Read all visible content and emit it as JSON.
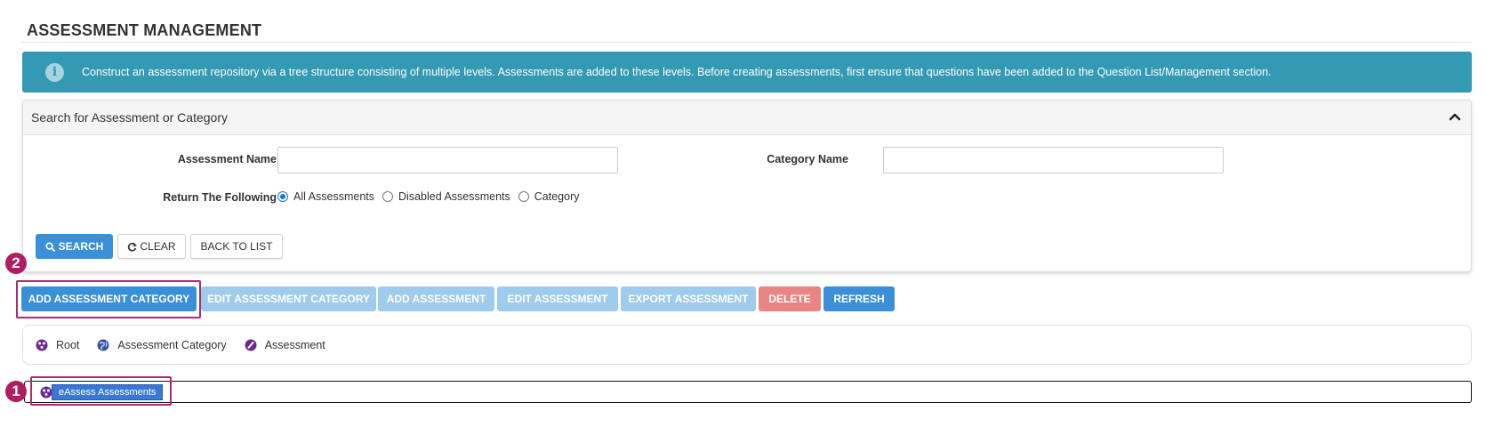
{
  "page": {
    "title": "ASSESSMENT MANAGEMENT"
  },
  "info": {
    "icon": "info-icon",
    "text": "Construct an assessment repository via a tree structure consisting of multiple levels. Assessments are added to these levels. Before creating assessments, first ensure that questions have been added to the Question List/Management section.",
    "color": "#3499b2"
  },
  "search_panel": {
    "title": "Search for Assessment or Category",
    "collapse_icon": "chevron-up-icon",
    "assessment_name_label": "Assessment Name",
    "assessment_name_value": "",
    "category_name_label": "Category Name",
    "category_name_value": "",
    "return_label": "Return The Following",
    "options": [
      "All Assessments",
      "Disabled Assessments",
      "Category"
    ],
    "selected_option": "All Assessments",
    "search_button": "SEARCH",
    "clear_button": "CLEAR",
    "back_button": "BACK TO LIST"
  },
  "toolbar": {
    "add_category": "ADD ASSESSMENT CATEGORY",
    "edit_category": "EDIT ASSESSMENT CATEGORY",
    "add_assessment": "ADD ASSESSMENT",
    "edit_assessment": "EDIT ASSESSMENT",
    "export_assessment": "EXPORT ASSESSMENT",
    "delete": "DELETE",
    "refresh": "REFRESH"
  },
  "legend": {
    "root": "Root",
    "category": "Assessment Category",
    "assessment": "Assessment"
  },
  "tree": {
    "root_node": "eAssess Assessments"
  },
  "annotations": {
    "badge_1": "1",
    "badge_2": "2",
    "color": "#b01d62"
  }
}
